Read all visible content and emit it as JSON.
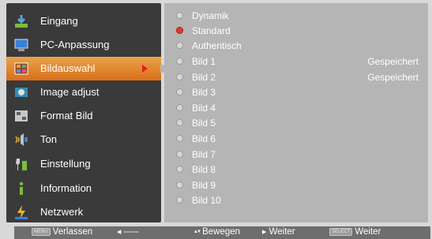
{
  "menu": {
    "items": [
      {
        "label": "Eingang",
        "icon": "input-icon"
      },
      {
        "label": "PC-Anpassung",
        "icon": "pc-adjust-icon"
      },
      {
        "label": "Bildauswahl",
        "icon": "image-select-icon"
      },
      {
        "label": "Image adjust",
        "icon": "image-adjust-icon"
      },
      {
        "label": "Format Bild",
        "icon": "screen-format-icon"
      },
      {
        "label": "Ton",
        "icon": "sound-icon"
      },
      {
        "label": "Einstellung",
        "icon": "setting-icon"
      },
      {
        "label": "Information",
        "icon": "information-icon"
      },
      {
        "label": "Netzwerk",
        "icon": "network-icon"
      }
    ],
    "active_index": 2
  },
  "options": [
    {
      "label": "Dynamik",
      "status": ""
    },
    {
      "label": "Standard",
      "status": "",
      "selected": true
    },
    {
      "label": "Authentisch",
      "status": ""
    },
    {
      "label": "Bild 1",
      "status": "Gespeichert"
    },
    {
      "label": "Bild 2",
      "status": "Gespeichert"
    },
    {
      "label": "Bild 3",
      "status": ""
    },
    {
      "label": "Bild 4",
      "status": ""
    },
    {
      "label": "Bild 5",
      "status": ""
    },
    {
      "label": "Bild 6",
      "status": ""
    },
    {
      "label": "Bild 7",
      "status": ""
    },
    {
      "label": "Bild 8",
      "status": ""
    },
    {
      "label": "Bild 9",
      "status": ""
    },
    {
      "label": "Bild 10",
      "status": ""
    }
  ],
  "bottombar": {
    "menu_key": "MENU",
    "exit": "Verlassen",
    "back_arrow": "◀",
    "back": "-----",
    "move_arrow": "▲▼",
    "move": "Bewegen",
    "next_arrow": "▶",
    "next": "Weiter",
    "select_key": "SELECT",
    "select": "Weiter"
  },
  "colors": {
    "menu_bg": "#3a3a3a",
    "active_bg": "#d96f1a",
    "options_bg": "#b5b5b5",
    "selected_radio": "#e03a2a"
  }
}
